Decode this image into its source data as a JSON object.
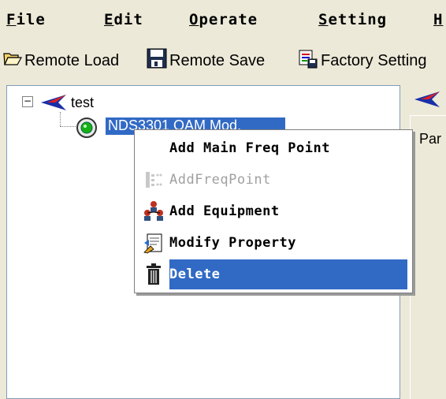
{
  "menubar": {
    "items": [
      {
        "label_first": "F",
        "label_rest": "ile"
      },
      {
        "label_first": "E",
        "label_rest": "dit"
      },
      {
        "label_first": "O",
        "label_rest": "perate"
      },
      {
        "label_first": "S",
        "label_rest": "etting"
      },
      {
        "label_first": "H",
        "label_rest": ""
      }
    ]
  },
  "toolbar": {
    "remote_load": "Remote Load",
    "remote_save": "Remote Save",
    "factory_setting": "Factory Setting"
  },
  "tree": {
    "root_label": "test",
    "child_label": "NDS3301 OAM Mod."
  },
  "right_panel": {
    "label": "Par"
  },
  "context_menu": {
    "items": [
      {
        "label": "Add Main Freq Point",
        "icon": "none",
        "enabled": true
      },
      {
        "label": "AddFreqPoint",
        "icon": "freq-point-icon",
        "enabled": false
      },
      {
        "label": "Add Equipment",
        "icon": "equipment-icon",
        "enabled": true
      },
      {
        "label": "Modify Property",
        "icon": "property-icon",
        "enabled": true
      },
      {
        "label": "Delete",
        "icon": "trash-icon",
        "enabled": true,
        "highlighted": true
      }
    ]
  },
  "colors": {
    "selection": "#316ac5",
    "chrome": "#ece9d8",
    "brand_arrow": "#1a2fa8"
  }
}
